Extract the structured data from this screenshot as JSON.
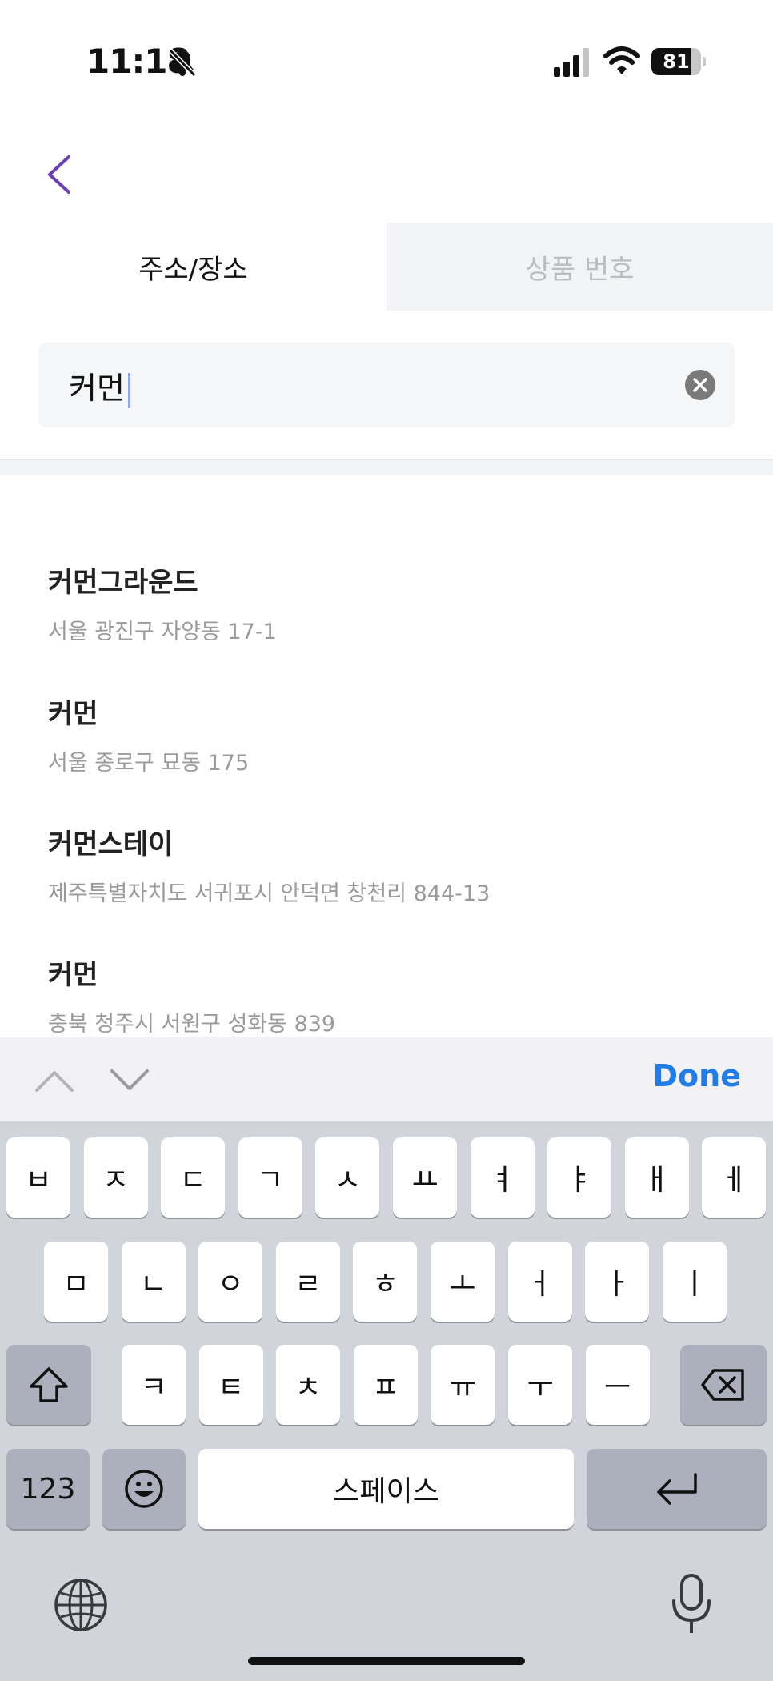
{
  "status_bar": {
    "time": "11:18",
    "battery": "81",
    "battery_level": 0.81
  },
  "tabs": [
    {
      "label": "주소/장소"
    },
    {
      "label": "상품 번호"
    }
  ],
  "search": {
    "value": "커먼"
  },
  "results": [
    {
      "name": "커먼그라운드",
      "address": "서울 광진구 자양동 17-1"
    },
    {
      "name": "커먼",
      "address": "서울 종로구 묘동 175"
    },
    {
      "name": "커먼스테이",
      "address": "제주특별자치도 서귀포시 안덕면 창천리 844-13"
    },
    {
      "name": "커먼",
      "address": "충북 청주시 서원구 성화동 839"
    }
  ],
  "toolbar": {
    "done_label": "Done"
  },
  "keyboard": {
    "row1": [
      "ㅂ",
      "ㅈ",
      "ㄷ",
      "ㄱ",
      "ㅅ",
      "ㅛ",
      "ㅕ",
      "ㅑ",
      "ㅐ",
      "ㅔ"
    ],
    "row2": [
      "ㅁ",
      "ㄴ",
      "ㅇ",
      "ㄹ",
      "ㅎ",
      "ㅗ",
      "ㅓ",
      "ㅏ",
      "ㅣ"
    ],
    "row3": [
      "ㅋ",
      "ㅌ",
      "ㅊ",
      "ㅍ",
      "ㅠ",
      "ㅜ",
      "ㅡ"
    ],
    "numbers_label": "123",
    "space_label": "스페이스"
  },
  "icons": {
    "back": "back-chevron-icon",
    "bell": "bell-slash-icon",
    "clear": "clear-circle-icon",
    "shift": "shift-icon",
    "delete": "delete-icon",
    "emoji": "emoji-icon",
    "return": "return-icon",
    "globe": "globe-icon",
    "mic": "microphone-icon"
  },
  "colors": {
    "accent": "#6a3fb5",
    "done": "#1f7ce8"
  }
}
